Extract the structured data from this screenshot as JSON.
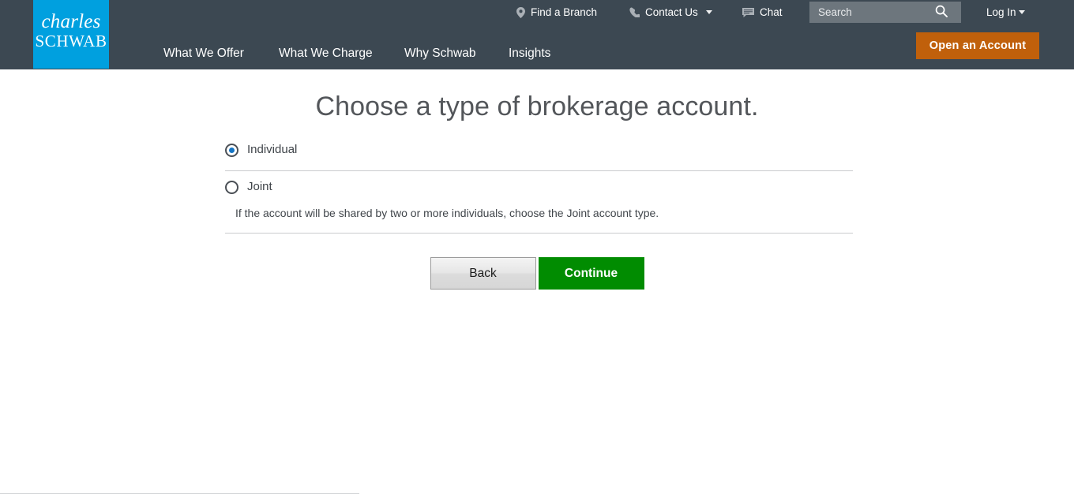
{
  "header": {
    "logo": {
      "line1": "charles",
      "line2": "SCHWAB",
      "color": "#00a0df"
    },
    "background_color": "#3c4852",
    "utility_nav": [
      {
        "label": "Find a Branch",
        "icon": "location-pin-icon"
      },
      {
        "label": "Contact Us",
        "icon": "phone-icon",
        "has_caret": true
      },
      {
        "label": "Chat",
        "icon": "chat-bubble-icon"
      }
    ],
    "search": {
      "placeholder": "Search",
      "value": "",
      "icon": "search-icon",
      "background_color": "#6d767d"
    },
    "login": {
      "label": "Log In",
      "has_caret": true
    },
    "main_nav": [
      {
        "label": "What We Offer"
      },
      {
        "label": "What We Charge"
      },
      {
        "label": "Why Schwab"
      },
      {
        "label": "Insights"
      }
    ],
    "cta": {
      "label": "Open an Account",
      "color": "#c0600b"
    }
  },
  "main": {
    "title": "Choose a type of brokerage account.",
    "options": [
      {
        "label": "Individual",
        "selected": true,
        "helper": ""
      },
      {
        "label": "Joint",
        "selected": false,
        "helper": "If the account will be shared by two or more individuals, choose the Joint account type."
      }
    ],
    "buttons": {
      "back": "Back",
      "continue": "Continue",
      "continue_color": "#018c01"
    }
  }
}
